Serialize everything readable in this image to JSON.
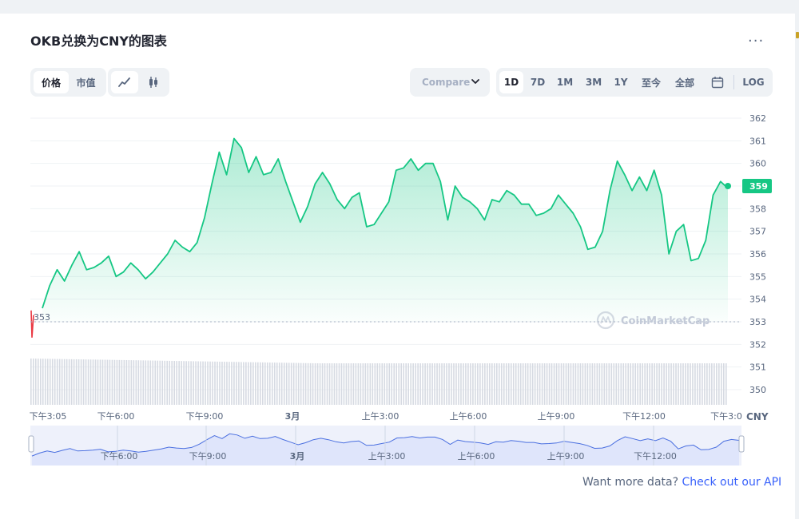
{
  "title": "OKB兑换为CNY的图表",
  "more_label": "...",
  "toggle_metric": [
    "价格",
    "市值"
  ],
  "compare_label": "Compare",
  "ranges": [
    "1D",
    "7D",
    "1M",
    "3M",
    "1Y",
    "至今",
    "全部"
  ],
  "log_label": "LOG",
  "currency_label": "CNY",
  "watermark": "CoinMarketCap",
  "footer_text": "Want more data?",
  "footer_link": "Check out our API",
  "colors": {
    "up": "#16c784",
    "down": "#ea3943",
    "accent": "#3861fb",
    "volume": "#d6dae2",
    "navigator": "#dfe5fb"
  },
  "icons": [
    "line-chart-icon",
    "candlestick-icon",
    "chevron-down-icon",
    "calendar-icon",
    "more-icon",
    "coinmarketcap-logo-icon"
  ],
  "chart_data": {
    "type": "line",
    "title": "",
    "xlabel": "",
    "ylabel": "",
    "ylim": [
      349.5,
      362.5
    ],
    "yticks": [
      362,
      361,
      360,
      359,
      358,
      357,
      356,
      355,
      354,
      353,
      352,
      351,
      350
    ],
    "xtick_labels": [
      "下午3:05",
      "下午6:00",
      "下午9:00",
      "3月",
      "上午3:00",
      "上午6:00",
      "上午9:00",
      "下午12:00",
      "下午3:0"
    ],
    "navigator_labels": [
      "下午6:00",
      "下午9:00",
      "3月",
      "上午3:00",
      "上午6:00",
      "上午9:00",
      "下午12:00"
    ],
    "open_price": 353,
    "current_price": 359,
    "grid": true,
    "series": [
      {
        "values": [
          353.6,
          354.6,
          355.3,
          354.8,
          355.5,
          356.1,
          355.3,
          355.4,
          355.6,
          355.9,
          355.0,
          355.2,
          355.6,
          355.3,
          354.9,
          355.2,
          355.6,
          356.0,
          356.6,
          356.3,
          356.1,
          356.5,
          357.6,
          359.1,
          360.5,
          359.5,
          361.1,
          360.7,
          359.6,
          360.3,
          359.5,
          359.6,
          360.2,
          359.2,
          358.3,
          357.4,
          358.1,
          359.1,
          359.6,
          359.1,
          358.4,
          358.0,
          358.5,
          358.7,
          357.2,
          357.3,
          357.8,
          358.3,
          359.7,
          359.8,
          360.2,
          359.7,
          360.0,
          360.0,
          359.2,
          357.5,
          359.0,
          358.5,
          358.3,
          358.0,
          357.5,
          358.4,
          358.3,
          358.8,
          358.6,
          358.2,
          358.2,
          357.7,
          357.8,
          358.0,
          358.6,
          358.2,
          357.8,
          357.2,
          356.2,
          356.3,
          357.0,
          358.8,
          360.1,
          359.5,
          358.8,
          359.4,
          358.8,
          359.7,
          358.6,
          356.0,
          357.0,
          357.3,
          355.7,
          355.8,
          356.6,
          358.6,
          359.2,
          358.9
        ],
        "current": 359.0
      }
    ]
  }
}
